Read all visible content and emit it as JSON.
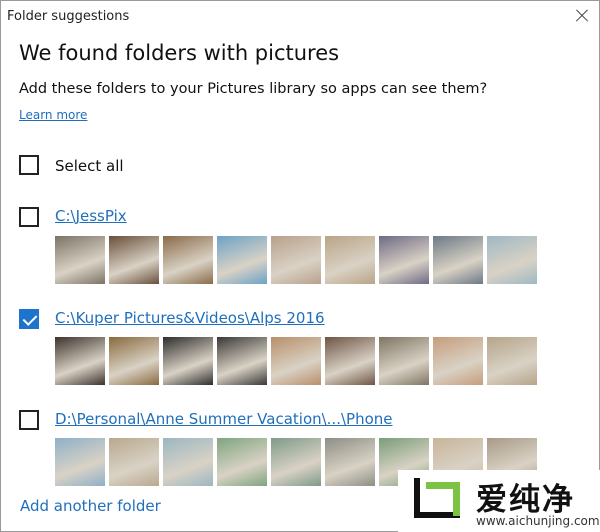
{
  "window": {
    "title": "Folder suggestions",
    "close_label": "×"
  },
  "heading": "We found folders with pictures",
  "description": "Add these folders to your Pictures library so apps can see them?",
  "learn_more": "Learn more",
  "select_all": {
    "label": "Select all",
    "checked": false
  },
  "folders": [
    {
      "path": "C:\\JessPix",
      "checked": false,
      "thumb_colors": [
        "#7b7466",
        "#6a4f3c",
        "#8a6b4a",
        "#6da2c7",
        "#b8a08c",
        "#b9a487",
        "#6e6a85",
        "#6c7a86",
        "#9fb8c4"
      ]
    },
    {
      "path": "C:\\Kuper Pictures&Videos\\Alps 2016",
      "checked": true,
      "thumb_colors": [
        "#3c332d",
        "#8a6a3e",
        "#2e2d2c",
        "#3a3836",
        "#b88f6a",
        "#6e5546",
        "#7f7563",
        "#c59d7c",
        "#b5a489"
      ]
    },
    {
      "path": "D:\\Personal\\Anne Summer Vacation\\...\\Phone",
      "checked": false,
      "thumb_colors": [
        "#8fb0c8",
        "#b9a88f",
        "#9bb7c2",
        "#7ea57e",
        "#7f9a89",
        "#8d8e85",
        "#7a9d78",
        "#c8b49a",
        "#a89a86"
      ]
    }
  ],
  "add_folder": "Add another folder",
  "watermark": {
    "chinese": "爱纯净",
    "url": "www.aichunjing.com",
    "accent": "#7cc243"
  },
  "colors": {
    "link": "#1f6fbd",
    "checkbox_checked": "#1e74cc"
  }
}
